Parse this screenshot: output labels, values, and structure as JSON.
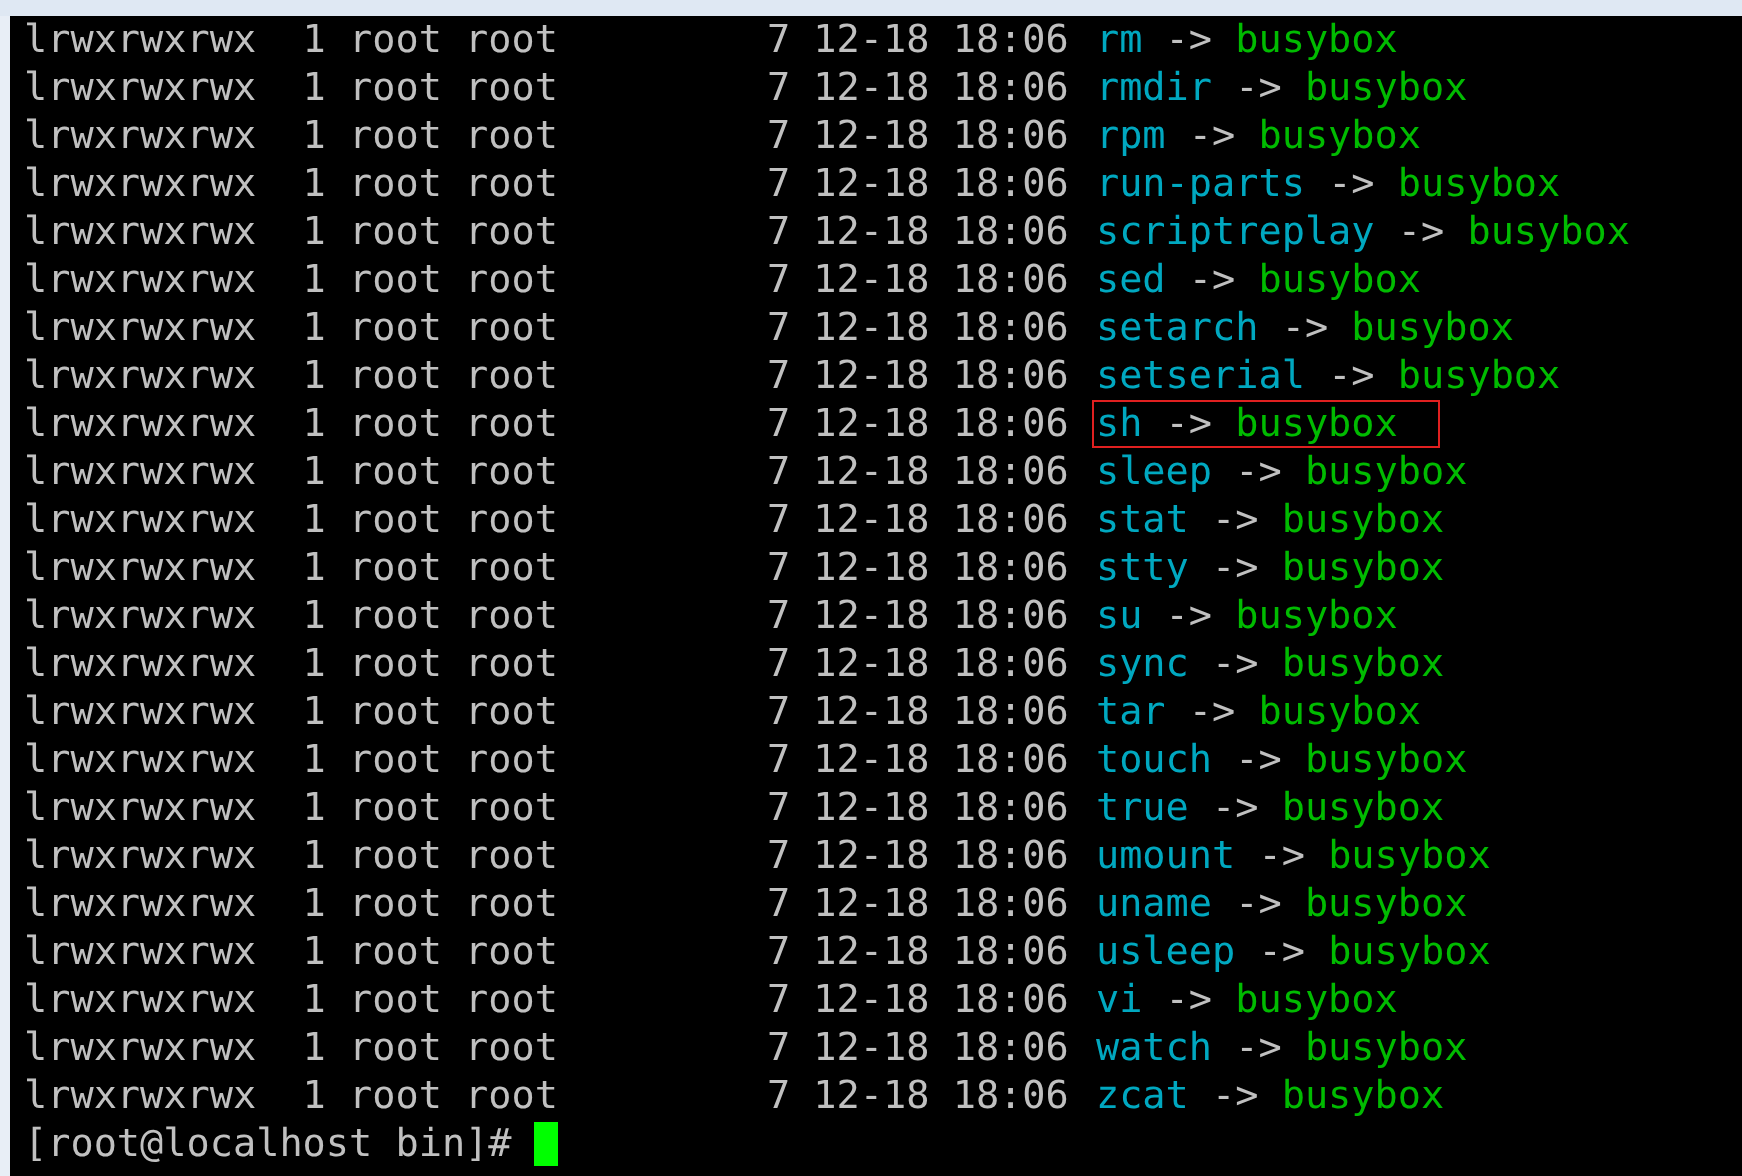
{
  "terminal": {
    "rows": [
      {
        "info": "lrwxrwxrwx  1 root root         7 12-18 18:06",
        "name": "rm",
        "arrow": "->",
        "target": "busybox",
        "highlighted": false
      },
      {
        "info": "lrwxrwxrwx  1 root root         7 12-18 18:06",
        "name": "rmdir",
        "arrow": "->",
        "target": "busybox",
        "highlighted": false
      },
      {
        "info": "lrwxrwxrwx  1 root root         7 12-18 18:06",
        "name": "rpm",
        "arrow": "->",
        "target": "busybox",
        "highlighted": false
      },
      {
        "info": "lrwxrwxrwx  1 root root         7 12-18 18:06",
        "name": "run-parts",
        "arrow": "->",
        "target": "busybox",
        "highlighted": false
      },
      {
        "info": "lrwxrwxrwx  1 root root         7 12-18 18:06",
        "name": "scriptreplay",
        "arrow": "->",
        "target": "busybox",
        "highlighted": false
      },
      {
        "info": "lrwxrwxrwx  1 root root         7 12-18 18:06",
        "name": "sed",
        "arrow": "->",
        "target": "busybox",
        "highlighted": false
      },
      {
        "info": "lrwxrwxrwx  1 root root         7 12-18 18:06",
        "name": "setarch",
        "arrow": "->",
        "target": "busybox",
        "highlighted": false
      },
      {
        "info": "lrwxrwxrwx  1 root root         7 12-18 18:06",
        "name": "setserial",
        "arrow": "->",
        "target": "busybox",
        "highlighted": false
      },
      {
        "info": "lrwxrwxrwx  1 root root         7 12-18 18:06",
        "name": "sh",
        "arrow": "->",
        "target": "busybox",
        "highlighted": true
      },
      {
        "info": "lrwxrwxrwx  1 root root         7 12-18 18:06",
        "name": "sleep",
        "arrow": "->",
        "target": "busybox",
        "highlighted": false
      },
      {
        "info": "lrwxrwxrwx  1 root root         7 12-18 18:06",
        "name": "stat",
        "arrow": "->",
        "target": "busybox",
        "highlighted": false
      },
      {
        "info": "lrwxrwxrwx  1 root root         7 12-18 18:06",
        "name": "stty",
        "arrow": "->",
        "target": "busybox",
        "highlighted": false
      },
      {
        "info": "lrwxrwxrwx  1 root root         7 12-18 18:06",
        "name": "su",
        "arrow": "->",
        "target": "busybox",
        "highlighted": false
      },
      {
        "info": "lrwxrwxrwx  1 root root         7 12-18 18:06",
        "name": "sync",
        "arrow": "->",
        "target": "busybox",
        "highlighted": false
      },
      {
        "info": "lrwxrwxrwx  1 root root         7 12-18 18:06",
        "name": "tar",
        "arrow": "->",
        "target": "busybox",
        "highlighted": false
      },
      {
        "info": "lrwxrwxrwx  1 root root         7 12-18 18:06",
        "name": "touch",
        "arrow": "->",
        "target": "busybox",
        "highlighted": false
      },
      {
        "info": "lrwxrwxrwx  1 root root         7 12-18 18:06",
        "name": "true",
        "arrow": "->",
        "target": "busybox",
        "highlighted": false
      },
      {
        "info": "lrwxrwxrwx  1 root root         7 12-18 18:06",
        "name": "umount",
        "arrow": "->",
        "target": "busybox",
        "highlighted": false
      },
      {
        "info": "lrwxrwxrwx  1 root root         7 12-18 18:06",
        "name": "uname",
        "arrow": "->",
        "target": "busybox",
        "highlighted": false
      },
      {
        "info": "lrwxrwxrwx  1 root root         7 12-18 18:06",
        "name": "usleep",
        "arrow": "->",
        "target": "busybox",
        "highlighted": false
      },
      {
        "info": "lrwxrwxrwx  1 root root         7 12-18 18:06",
        "name": "vi",
        "arrow": "->",
        "target": "busybox",
        "highlighted": false
      },
      {
        "info": "lrwxrwxrwx  1 root root         7 12-18 18:06",
        "name": "watch",
        "arrow": "->",
        "target": "busybox",
        "highlighted": false
      },
      {
        "info": "lrwxrwxrwx  1 root root         7 12-18 18:06",
        "name": "zcat",
        "arrow": "->",
        "target": "busybox",
        "highlighted": false
      }
    ],
    "prompt": "[root@localhost bin]#"
  }
}
